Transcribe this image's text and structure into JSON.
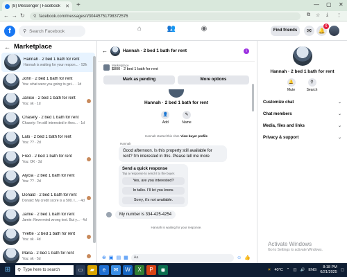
{
  "browser": {
    "tab_title": "(8) Messenger | Facebook",
    "url": "facebook.com/messages/t/30445751798372576"
  },
  "header": {
    "search_placeholder": "Search Facebook",
    "find_friends": "Find friends",
    "notif_count": "6"
  },
  "left": {
    "title": "Marketplace",
    "conversations": [
      {
        "name": "Hannah · 2 bed 1 bath for rent",
        "preview": "Hannah is waiting for your respon... · 52h",
        "active": true
      },
      {
        "name": "John · 2 bed 1 bath for rent",
        "preview": "You: what were you going to get... · 1d"
      },
      {
        "name": "Janice · 2 bed 1 bath for rent",
        "preview": "You: ok · 1d"
      },
      {
        "name": "Chasety · 2 bed 1 bath for rent",
        "preview": "Chasety: I'm still interested in thes... · 1d"
      },
      {
        "name": "Lalo · 2 bed 1 bath for rent",
        "preview": "You: ?? · 2d"
      },
      {
        "name": "Fred · 2 bed 1 bath for rent",
        "preview": "You: OK · 3d"
      },
      {
        "name": "Alycia · 2 bed 1 bath for rent",
        "preview": "You: ?? · 2d"
      },
      {
        "name": "Donald · 2 bed 1 bath for rent",
        "preview": "Donald: My credit score is a 500. I... · 4d"
      },
      {
        "name": "Jamie · 2 bed 1 bath for rent",
        "preview": "Jamie: Nevermind wrong text. But y... · 4d"
      },
      {
        "name": "Yvette · 2 bed 1 bath for rent",
        "preview": "You: ok · 4d"
      },
      {
        "name": "Maria · 2 bed 1 bath for rent",
        "preview": "You: ok · 5d"
      }
    ]
  },
  "chat": {
    "title": "Hannah · 2 bed 1 bath for rent",
    "listing_label": "Marketplace",
    "listing_price": "$800 · 2 bed 1 bath for rent",
    "mark_pending": "Mark as pending",
    "more_options": "More options",
    "profile_name": "Hannah · 2 bed 1 bath for rent",
    "add_label": "Add",
    "name_label": "Name",
    "sys_note": "Hannah started this chat.",
    "view_profile": "View buyer profile",
    "sender": "Hannah",
    "message": "Good afternoon. Is this property still available for rent? I'm interested in this. Please tell me more",
    "qr_title": "Send a quick response",
    "qr_sub": "Tap a response to send it to the buyer.",
    "quick_replies": [
      "Yes, are you interested?",
      "In talks. I'll let you know.",
      "Sorry, it's not available."
    ],
    "reply": "My number is 334-425-4254",
    "waiting": "Hannah is waiting for your response.",
    "composer_value": "Aa"
  },
  "right": {
    "name": "Hannah · 2 bed 1 bath for rent",
    "mute": "Mute",
    "search": "Search",
    "menu": [
      "Customize chat",
      "Chat members",
      "Media, files and links",
      "Privacy & support"
    ],
    "watermark_title": "Activate Windows",
    "watermark_sub": "Go to Settings to activate Windows."
  },
  "taskbar": {
    "search_placeholder": "Type here to search",
    "temp": "40°C",
    "lang": "ENG",
    "time": "8:18 PM",
    "date": "6/21/2025"
  },
  "colors": {
    "accent": "#1877f2",
    "active_row": "#e7f3ff",
    "taskbar": "#0f1e33"
  }
}
